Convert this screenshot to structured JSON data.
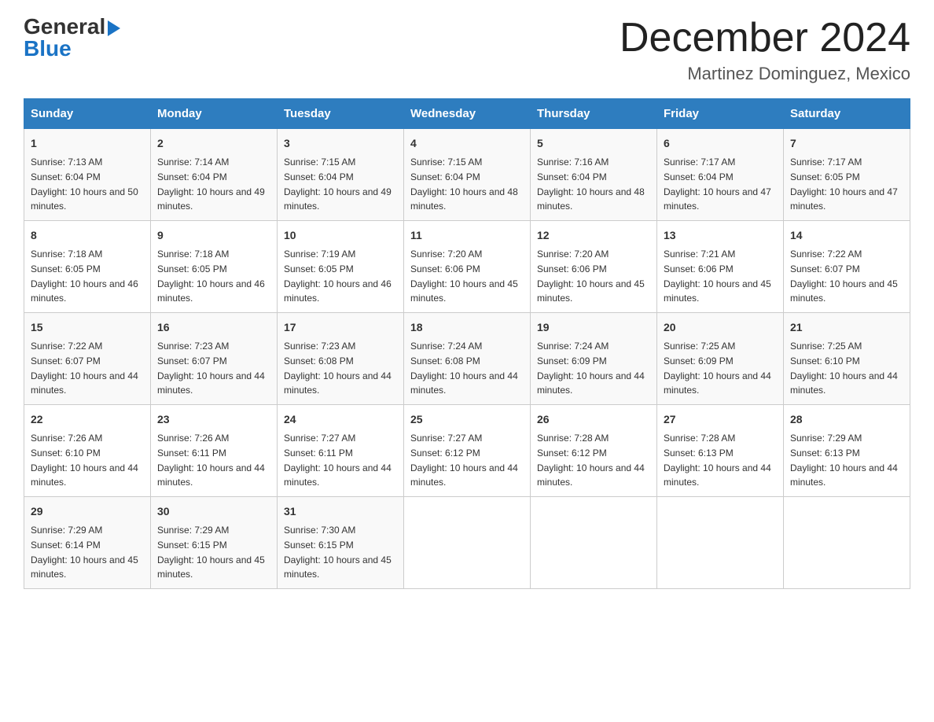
{
  "logo": {
    "general": "General",
    "blue": "Blue"
  },
  "header": {
    "title": "December 2024",
    "subtitle": "Martinez Dominguez, Mexico"
  },
  "days_of_week": [
    "Sunday",
    "Monday",
    "Tuesday",
    "Wednesday",
    "Thursday",
    "Friday",
    "Saturday"
  ],
  "weeks": [
    [
      {
        "day": "1",
        "sunrise": "7:13 AM",
        "sunset": "6:04 PM",
        "daylight": "10 hours and 50 minutes."
      },
      {
        "day": "2",
        "sunrise": "7:14 AM",
        "sunset": "6:04 PM",
        "daylight": "10 hours and 49 minutes."
      },
      {
        "day": "3",
        "sunrise": "7:15 AM",
        "sunset": "6:04 PM",
        "daylight": "10 hours and 49 minutes."
      },
      {
        "day": "4",
        "sunrise": "7:15 AM",
        "sunset": "6:04 PM",
        "daylight": "10 hours and 48 minutes."
      },
      {
        "day": "5",
        "sunrise": "7:16 AM",
        "sunset": "6:04 PM",
        "daylight": "10 hours and 48 minutes."
      },
      {
        "day": "6",
        "sunrise": "7:17 AM",
        "sunset": "6:04 PM",
        "daylight": "10 hours and 47 minutes."
      },
      {
        "day": "7",
        "sunrise": "7:17 AM",
        "sunset": "6:05 PM",
        "daylight": "10 hours and 47 minutes."
      }
    ],
    [
      {
        "day": "8",
        "sunrise": "7:18 AM",
        "sunset": "6:05 PM",
        "daylight": "10 hours and 46 minutes."
      },
      {
        "day": "9",
        "sunrise": "7:18 AM",
        "sunset": "6:05 PM",
        "daylight": "10 hours and 46 minutes."
      },
      {
        "day": "10",
        "sunrise": "7:19 AM",
        "sunset": "6:05 PM",
        "daylight": "10 hours and 46 minutes."
      },
      {
        "day": "11",
        "sunrise": "7:20 AM",
        "sunset": "6:06 PM",
        "daylight": "10 hours and 45 minutes."
      },
      {
        "day": "12",
        "sunrise": "7:20 AM",
        "sunset": "6:06 PM",
        "daylight": "10 hours and 45 minutes."
      },
      {
        "day": "13",
        "sunrise": "7:21 AM",
        "sunset": "6:06 PM",
        "daylight": "10 hours and 45 minutes."
      },
      {
        "day": "14",
        "sunrise": "7:22 AM",
        "sunset": "6:07 PM",
        "daylight": "10 hours and 45 minutes."
      }
    ],
    [
      {
        "day": "15",
        "sunrise": "7:22 AM",
        "sunset": "6:07 PM",
        "daylight": "10 hours and 44 minutes."
      },
      {
        "day": "16",
        "sunrise": "7:23 AM",
        "sunset": "6:07 PM",
        "daylight": "10 hours and 44 minutes."
      },
      {
        "day": "17",
        "sunrise": "7:23 AM",
        "sunset": "6:08 PM",
        "daylight": "10 hours and 44 minutes."
      },
      {
        "day": "18",
        "sunrise": "7:24 AM",
        "sunset": "6:08 PM",
        "daylight": "10 hours and 44 minutes."
      },
      {
        "day": "19",
        "sunrise": "7:24 AM",
        "sunset": "6:09 PM",
        "daylight": "10 hours and 44 minutes."
      },
      {
        "day": "20",
        "sunrise": "7:25 AM",
        "sunset": "6:09 PM",
        "daylight": "10 hours and 44 minutes."
      },
      {
        "day": "21",
        "sunrise": "7:25 AM",
        "sunset": "6:10 PM",
        "daylight": "10 hours and 44 minutes."
      }
    ],
    [
      {
        "day": "22",
        "sunrise": "7:26 AM",
        "sunset": "6:10 PM",
        "daylight": "10 hours and 44 minutes."
      },
      {
        "day": "23",
        "sunrise": "7:26 AM",
        "sunset": "6:11 PM",
        "daylight": "10 hours and 44 minutes."
      },
      {
        "day": "24",
        "sunrise": "7:27 AM",
        "sunset": "6:11 PM",
        "daylight": "10 hours and 44 minutes."
      },
      {
        "day": "25",
        "sunrise": "7:27 AM",
        "sunset": "6:12 PM",
        "daylight": "10 hours and 44 minutes."
      },
      {
        "day": "26",
        "sunrise": "7:28 AM",
        "sunset": "6:12 PM",
        "daylight": "10 hours and 44 minutes."
      },
      {
        "day": "27",
        "sunrise": "7:28 AM",
        "sunset": "6:13 PM",
        "daylight": "10 hours and 44 minutes."
      },
      {
        "day": "28",
        "sunrise": "7:29 AM",
        "sunset": "6:13 PM",
        "daylight": "10 hours and 44 minutes."
      }
    ],
    [
      {
        "day": "29",
        "sunrise": "7:29 AM",
        "sunset": "6:14 PM",
        "daylight": "10 hours and 45 minutes."
      },
      {
        "day": "30",
        "sunrise": "7:29 AM",
        "sunset": "6:15 PM",
        "daylight": "10 hours and 45 minutes."
      },
      {
        "day": "31",
        "sunrise": "7:30 AM",
        "sunset": "6:15 PM",
        "daylight": "10 hours and 45 minutes."
      },
      null,
      null,
      null,
      null
    ]
  ],
  "labels": {
    "sunrise": "Sunrise:",
    "sunset": "Sunset:",
    "daylight": "Daylight:"
  }
}
